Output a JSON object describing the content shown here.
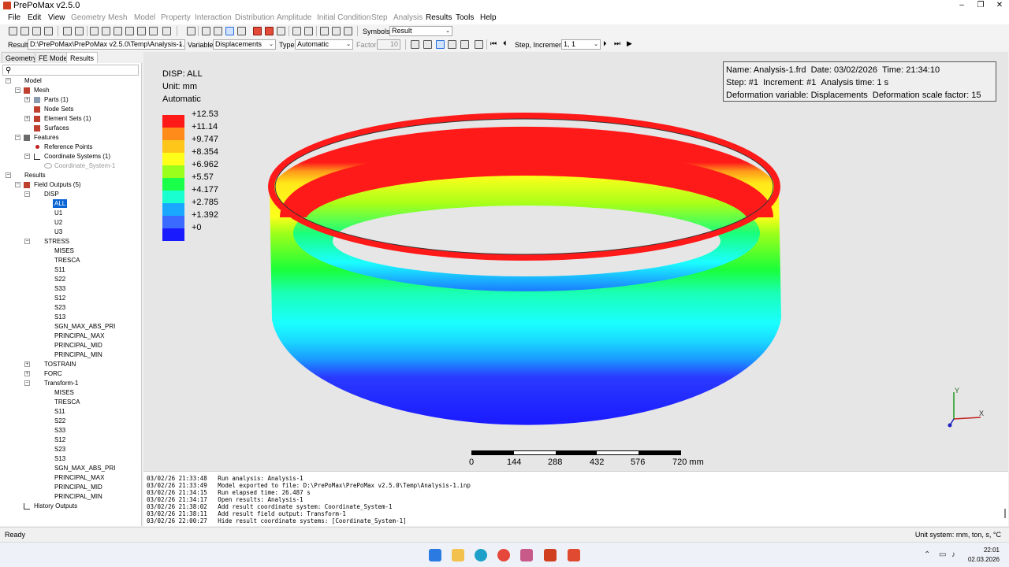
{
  "window": {
    "title": "PrePoMax v2.5.0"
  },
  "menu": [
    "File",
    "Edit",
    "View",
    "Geometry",
    "Mesh",
    "Model",
    "Property",
    "Interaction",
    "Distribution",
    "Amplitude",
    "Initial Condition",
    "Step",
    "Analysis",
    "Results",
    "Tools",
    "Help"
  ],
  "toolbar": {
    "symbols_label": "Symbols",
    "symbols_value": "Result",
    "result_label": "Result",
    "result_value": "D:\\PrePoMax\\PrePoMax v2.5.0\\Temp\\Analysis-1.frd",
    "variable_label": "Variable",
    "variable_value": "Displacements",
    "type_label": "Type",
    "type_value": "Automatic",
    "factor_label": "Factor",
    "factor_value": "10",
    "step_label": "Step, Increment",
    "step_value": "1, 1"
  },
  "tabs": [
    "Geometry",
    "FE Model",
    "Results"
  ],
  "tree": {
    "model": "Model",
    "mesh": "Mesh",
    "parts": "Parts (1)",
    "node_sets": "Node Sets",
    "element_sets": "Element Sets (1)",
    "surfaces": "Surfaces",
    "features": "Features",
    "reference_points": "Reference Points",
    "coordinate_systems": "Coordinate Systems (1)",
    "coordinate_system_1": "Coordinate_System-1",
    "results": "Results",
    "field_outputs": "Field Outputs (5)",
    "disp": "DISP",
    "disp_items": [
      "ALL",
      "U1",
      "U2",
      "U3"
    ],
    "stress": "STRESS",
    "stress_items": [
      "MISES",
      "TRESCA",
      "S11",
      "S22",
      "S33",
      "S12",
      "S23",
      "S13",
      "SGN_MAX_ABS_PRI",
      "PRINCIPAL_MAX",
      "PRINCIPAL_MID",
      "PRINCIPAL_MIN"
    ],
    "tostrain": "TOSTRAIN",
    "forc": "FORC",
    "transform": "Transform-1",
    "transform_items": [
      "MISES",
      "TRESCA",
      "S11",
      "S22",
      "S33",
      "S12",
      "S23",
      "S13",
      "SGN_MAX_ABS_PRI",
      "PRINCIPAL_MAX",
      "PRINCIPAL_MID",
      "PRINCIPAL_MIN"
    ],
    "history_outputs": "History Outputs"
  },
  "legend": {
    "title": "DISP: ALL",
    "unit": "Unit: mm",
    "mode": "Automatic",
    "values": [
      "+12.53",
      "+11.14",
      "+9.747",
      "+8.354",
      "+6.962",
      "+5.57",
      "+4.177",
      "+2.785",
      "+1.392",
      "+0"
    ],
    "colors": [
      "#ff1a1a",
      "#ff8c1a",
      "#ffc61a",
      "#ffff1a",
      "#9aff1a",
      "#1aff4a",
      "#1affd0",
      "#1aa8ff",
      "#3a6aff",
      "#1a1aff"
    ]
  },
  "info": {
    "name": "Name: Analysis-1.frd",
    "date": "Date: 03/02/2026",
    "time": "Time: 21:34:10",
    "step": "Step: #1",
    "increment": "Increment: #1",
    "analysis_time": "Analysis time: 1 s",
    "deformation_variable": "Deformation variable: Displacements",
    "deformation_scale": "Deformation scale factor: 15"
  },
  "scale_labels": [
    "0",
    "144",
    "288",
    "432",
    "576",
    "720 mm"
  ],
  "axes": {
    "y": "Y",
    "x": "X"
  },
  "log": [
    "03/02/26 21:33:48   Run analysis: Analysis-1",
    "03/02/26 21:33:49   Model exported to file: D:\\PrePoMax\\PrePoMax v2.5.0\\Temp\\Analysis-1.inp",
    "03/02/26 21:34:15   Run elapsed time: 26.487 s",
    "03/02/26 21:34:17   Open results: Analysis-1",
    "03/02/26 21:38:02   Add result coordinate system: Coordinate_System-1",
    "03/02/26 21:38:11   Add result field output: Transform-1",
    "03/02/26 22:00:27   Hide result coordinate systems: [Coordinate_System-1]"
  ],
  "status": {
    "left": "Ready",
    "right": "Unit system: mm, ton, s, °C"
  },
  "clock": {
    "time": "22:01",
    "date": "02.03.2026"
  }
}
